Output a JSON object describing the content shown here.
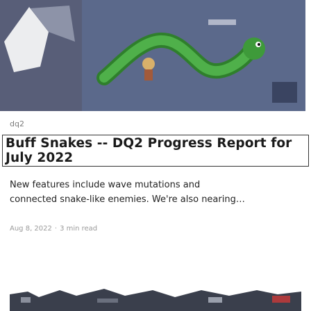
{
  "post": {
    "tag": "dq2",
    "title": "Buff Snakes -- DQ2 Progress Report for July 2022",
    "summary_line1": "New features include wave mutations and",
    "summary_line2": "connected snake-like enemies. We're also nearing",
    "date": "Aug 8, 2022",
    "read_time": "3 min read"
  },
  "colors": {
    "hero_bg": "#5a6a8a",
    "snake": "#3e9a3a",
    "border": "#333333"
  }
}
